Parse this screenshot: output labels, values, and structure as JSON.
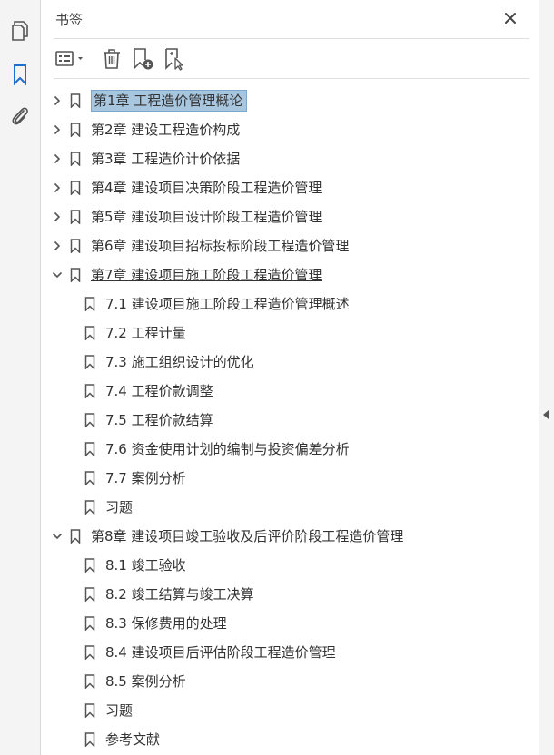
{
  "panel": {
    "title": "书签",
    "close_icon": "close-icon"
  },
  "toolbar": {
    "items": [
      "options-menu-icon",
      "delete-icon",
      "new-bookmark-icon",
      "new-bookmark-from-selection-icon"
    ]
  },
  "colors": {
    "selection_bg": "#a9c6df",
    "selection_border": "#7da7cc",
    "accent": "#1a6fd0"
  },
  "bookmarks": [
    {
      "label": "第1章  工程造价管理概论",
      "level": 0,
      "expanded": false,
      "selected": true
    },
    {
      "label": "第2章  建设工程造价构成",
      "level": 0,
      "expanded": false
    },
    {
      "label": "第3章  工程造价计价依据",
      "level": 0,
      "expanded": false
    },
    {
      "label": "第4章  建设项目决策阶段工程造价管理",
      "level": 0,
      "expanded": false
    },
    {
      "label": "第5章  建设项目设计阶段工程造价管理",
      "level": 0,
      "expanded": false
    },
    {
      "label": "第6章  建设项目招标投标阶段工程造价管理",
      "level": 0,
      "expanded": false
    },
    {
      "label": "第7章  建设项目施工阶段工程造价管理",
      "level": 0,
      "expanded": true,
      "underlined": true
    },
    {
      "label": "7.1  建设项目施工阶段工程造价管理概述",
      "level": 1
    },
    {
      "label": "7.2  工程计量",
      "level": 1
    },
    {
      "label": "7.3  施工组织设计的优化",
      "level": 1
    },
    {
      "label": "7.4  工程价款调整",
      "level": 1
    },
    {
      "label": "7.5  工程价款结算",
      "level": 1
    },
    {
      "label": "7.6  资金使用计划的编制与投资偏差分析",
      "level": 1
    },
    {
      "label": "7.7  案例分析",
      "level": 1
    },
    {
      "label": "习题",
      "level": 1
    },
    {
      "label": "第8章  建设项目竣工验收及后评价阶段工程造价管理",
      "level": 0,
      "expanded": true
    },
    {
      "label": "8.1  竣工验收",
      "level": 1
    },
    {
      "label": "8.2  竣工结算与竣工决算",
      "level": 1
    },
    {
      "label": "8.3  保修费用的处理",
      "level": 1
    },
    {
      "label": "8.4  建设项目后评估阶段工程造价管理",
      "level": 1
    },
    {
      "label": "8.5  案例分析",
      "level": 1
    },
    {
      "label": "习题",
      "level": 1
    },
    {
      "label": "参考文献",
      "level": 1
    }
  ]
}
